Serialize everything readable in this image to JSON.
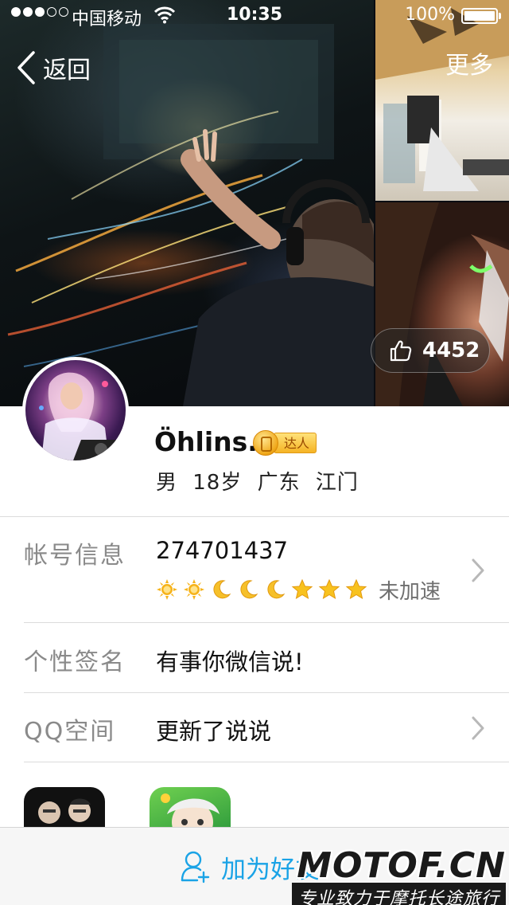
{
  "status_bar": {
    "carrier": "中国移动",
    "time": "10:35",
    "battery": "100%",
    "signal_strength": 3
  },
  "nav": {
    "back_label": "返回",
    "more_label": "更多"
  },
  "likes": {
    "count": "4452"
  },
  "profile": {
    "name": "Öhlins.",
    "badge": "达人",
    "info": "男 18岁 广东 江门"
  },
  "account": {
    "label": "帐号信息",
    "qq_number": "274701437",
    "level_icons": [
      "sun-icon",
      "sun-icon",
      "moon-icon",
      "moon-icon",
      "moon-icon",
      "star-icon",
      "star-icon",
      "star-icon"
    ],
    "speed_status": "未加速"
  },
  "signature": {
    "label": "个性签名",
    "value": "有事你微信说!"
  },
  "qzone": {
    "label": "QQ空间",
    "value": "更新了说说"
  },
  "footer": {
    "add_friend_label": "加为好友",
    "watermark_main": "MOTOF.CN",
    "watermark_sub": "专业致力于摩托长途旅行"
  },
  "colors": {
    "accent": "#1aa3e6",
    "label_gray": "#8a8a8a",
    "badge_gold": "#f5b324"
  }
}
